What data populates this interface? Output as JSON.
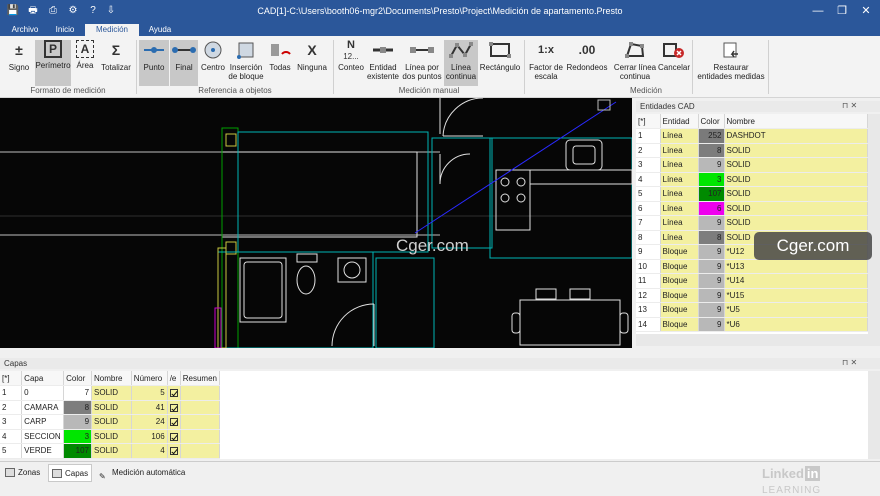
{
  "window": {
    "title": "CAD[1]-C:\\Users\\booth06-mgr2\\Documents\\Presto\\Project\\Medición de apartamento.Presto",
    "minimize": "—",
    "restore": "❐",
    "close": "✕"
  },
  "quick_access": {
    "save": "💾",
    "print": "🖶",
    "icons": [
      "⎙",
      "⚙",
      "?",
      "⇩"
    ]
  },
  "tabs": [
    "Archivo",
    "Inicio",
    "Medición",
    "Ayuda"
  ],
  "ribbon": {
    "groups": [
      {
        "label": "Formato de medición"
      },
      {
        "label": "Referencia a objetos"
      },
      {
        "label": "Medición manual"
      },
      {
        "label": "Medición"
      }
    ],
    "buttons": {
      "signo": {
        "label": "Signo",
        "icon": "±"
      },
      "perimetro": {
        "label": "Perímetro",
        "icon": "P"
      },
      "area": {
        "label": "Área",
        "icon": "A"
      },
      "totalizar": {
        "label": "Totalizar",
        "icon": "Σ"
      },
      "punto": {
        "label": "Punto"
      },
      "final": {
        "label": "Final"
      },
      "centro": {
        "label": "Centro"
      },
      "insercion": {
        "label": "Inserción de bloque"
      },
      "todas": {
        "label": "Todas"
      },
      "ninguna": {
        "label": "Ninguna",
        "icon": "X"
      },
      "conteo": {
        "label": "Conteo",
        "icon": "N",
        "sub": "12..."
      },
      "existente": {
        "label": "Entidad existente"
      },
      "dospuntos": {
        "label": "Línea por dos puntos"
      },
      "continua": {
        "label": "Línea continua"
      },
      "rectangulo": {
        "label": "Rectángulo"
      },
      "factor": {
        "label": "Factor de escala",
        "icon": "1:x"
      },
      "redondeos": {
        "label": "Redondeos",
        "icon": ".00"
      },
      "cerrar": {
        "label": "Cerrar línea continua"
      },
      "cancelar": {
        "label": "Cancelar"
      },
      "restaurar": {
        "label": "Restaurar entidades medidas"
      }
    }
  },
  "watermark": "Cger.com",
  "entidades": {
    "title": "Entidades CAD",
    "columns": [
      "[*]",
      "Entidad",
      "Color",
      "Nombre"
    ],
    "rows": [
      {
        "n": "1",
        "entidad": "Línea",
        "color": "252",
        "nombre": "DASHDOT",
        "swatch": "#7a7a7a"
      },
      {
        "n": "2",
        "entidad": "Línea",
        "color": "8",
        "nombre": "SOLID",
        "swatch": "#7d7d7d"
      },
      {
        "n": "3",
        "entidad": "Línea",
        "color": "9",
        "nombre": "SOLID",
        "swatch": "#b8b8b8"
      },
      {
        "n": "4",
        "entidad": "Línea",
        "color": "3",
        "nombre": "SOLID",
        "swatch": "#00e600"
      },
      {
        "n": "5",
        "entidad": "Línea",
        "color": "107",
        "nombre": "SOLID",
        "swatch": "#008a00"
      },
      {
        "n": "6",
        "entidad": "Línea",
        "color": "6",
        "nombre": "SOLID",
        "swatch": "#ee00ee"
      },
      {
        "n": "7",
        "entidad": "Línea",
        "color": "9",
        "nombre": "SOLID",
        "swatch": "#b8b8b8"
      },
      {
        "n": "8",
        "entidad": "Línea",
        "color": "8",
        "nombre": "SOLID",
        "swatch": "#7d7d7d"
      },
      {
        "n": "9",
        "entidad": "Bloque",
        "color": "9",
        "nombre": "*U12",
        "swatch": "#b8b8b8"
      },
      {
        "n": "10",
        "entidad": "Bloque",
        "color": "9",
        "nombre": "*U13",
        "swatch": "#b8b8b8"
      },
      {
        "n": "11",
        "entidad": "Bloque",
        "color": "9",
        "nombre": "*U14",
        "swatch": "#b8b8b8"
      },
      {
        "n": "12",
        "entidad": "Bloque",
        "color": "9",
        "nombre": "*U15",
        "swatch": "#b8b8b8"
      },
      {
        "n": "13",
        "entidad": "Bloque",
        "color": "9",
        "nombre": "*U5",
        "swatch": "#b8b8b8"
      },
      {
        "n": "14",
        "entidad": "Bloque",
        "color": "9",
        "nombre": "*U6",
        "swatch": "#b8b8b8"
      }
    ]
  },
  "capas": {
    "title": "Capas",
    "columns": [
      "[*]",
      "Capa",
      "Color",
      "Nombre",
      "Número",
      "/e",
      "Resumen"
    ],
    "rows": [
      {
        "n": "1",
        "capa": "0",
        "color": "7",
        "nombre": "SOLID",
        "numero": "5",
        "swatch": "#ffffff"
      },
      {
        "n": "2",
        "capa": "CAMARA",
        "color": "8",
        "nombre": "SOLID",
        "numero": "41",
        "swatch": "#7d7d7d"
      },
      {
        "n": "3",
        "capa": "CARP",
        "color": "9",
        "nombre": "SOLID",
        "numero": "24",
        "swatch": "#b8b8b8"
      },
      {
        "n": "4",
        "capa": "SECCION",
        "color": "3",
        "nombre": "SOLID",
        "numero": "106",
        "swatch": "#00e600"
      },
      {
        "n": "5",
        "capa": "VERDE",
        "color": "107",
        "nombre": "SOLID",
        "numero": "4",
        "swatch": "#008a00"
      }
    ]
  },
  "bottom_tabs": [
    "Zonas",
    "Capas",
    "Medición automática"
  ],
  "linkedin": {
    "linked": "Linked",
    "in": "in",
    "learning": "LEARNING"
  }
}
